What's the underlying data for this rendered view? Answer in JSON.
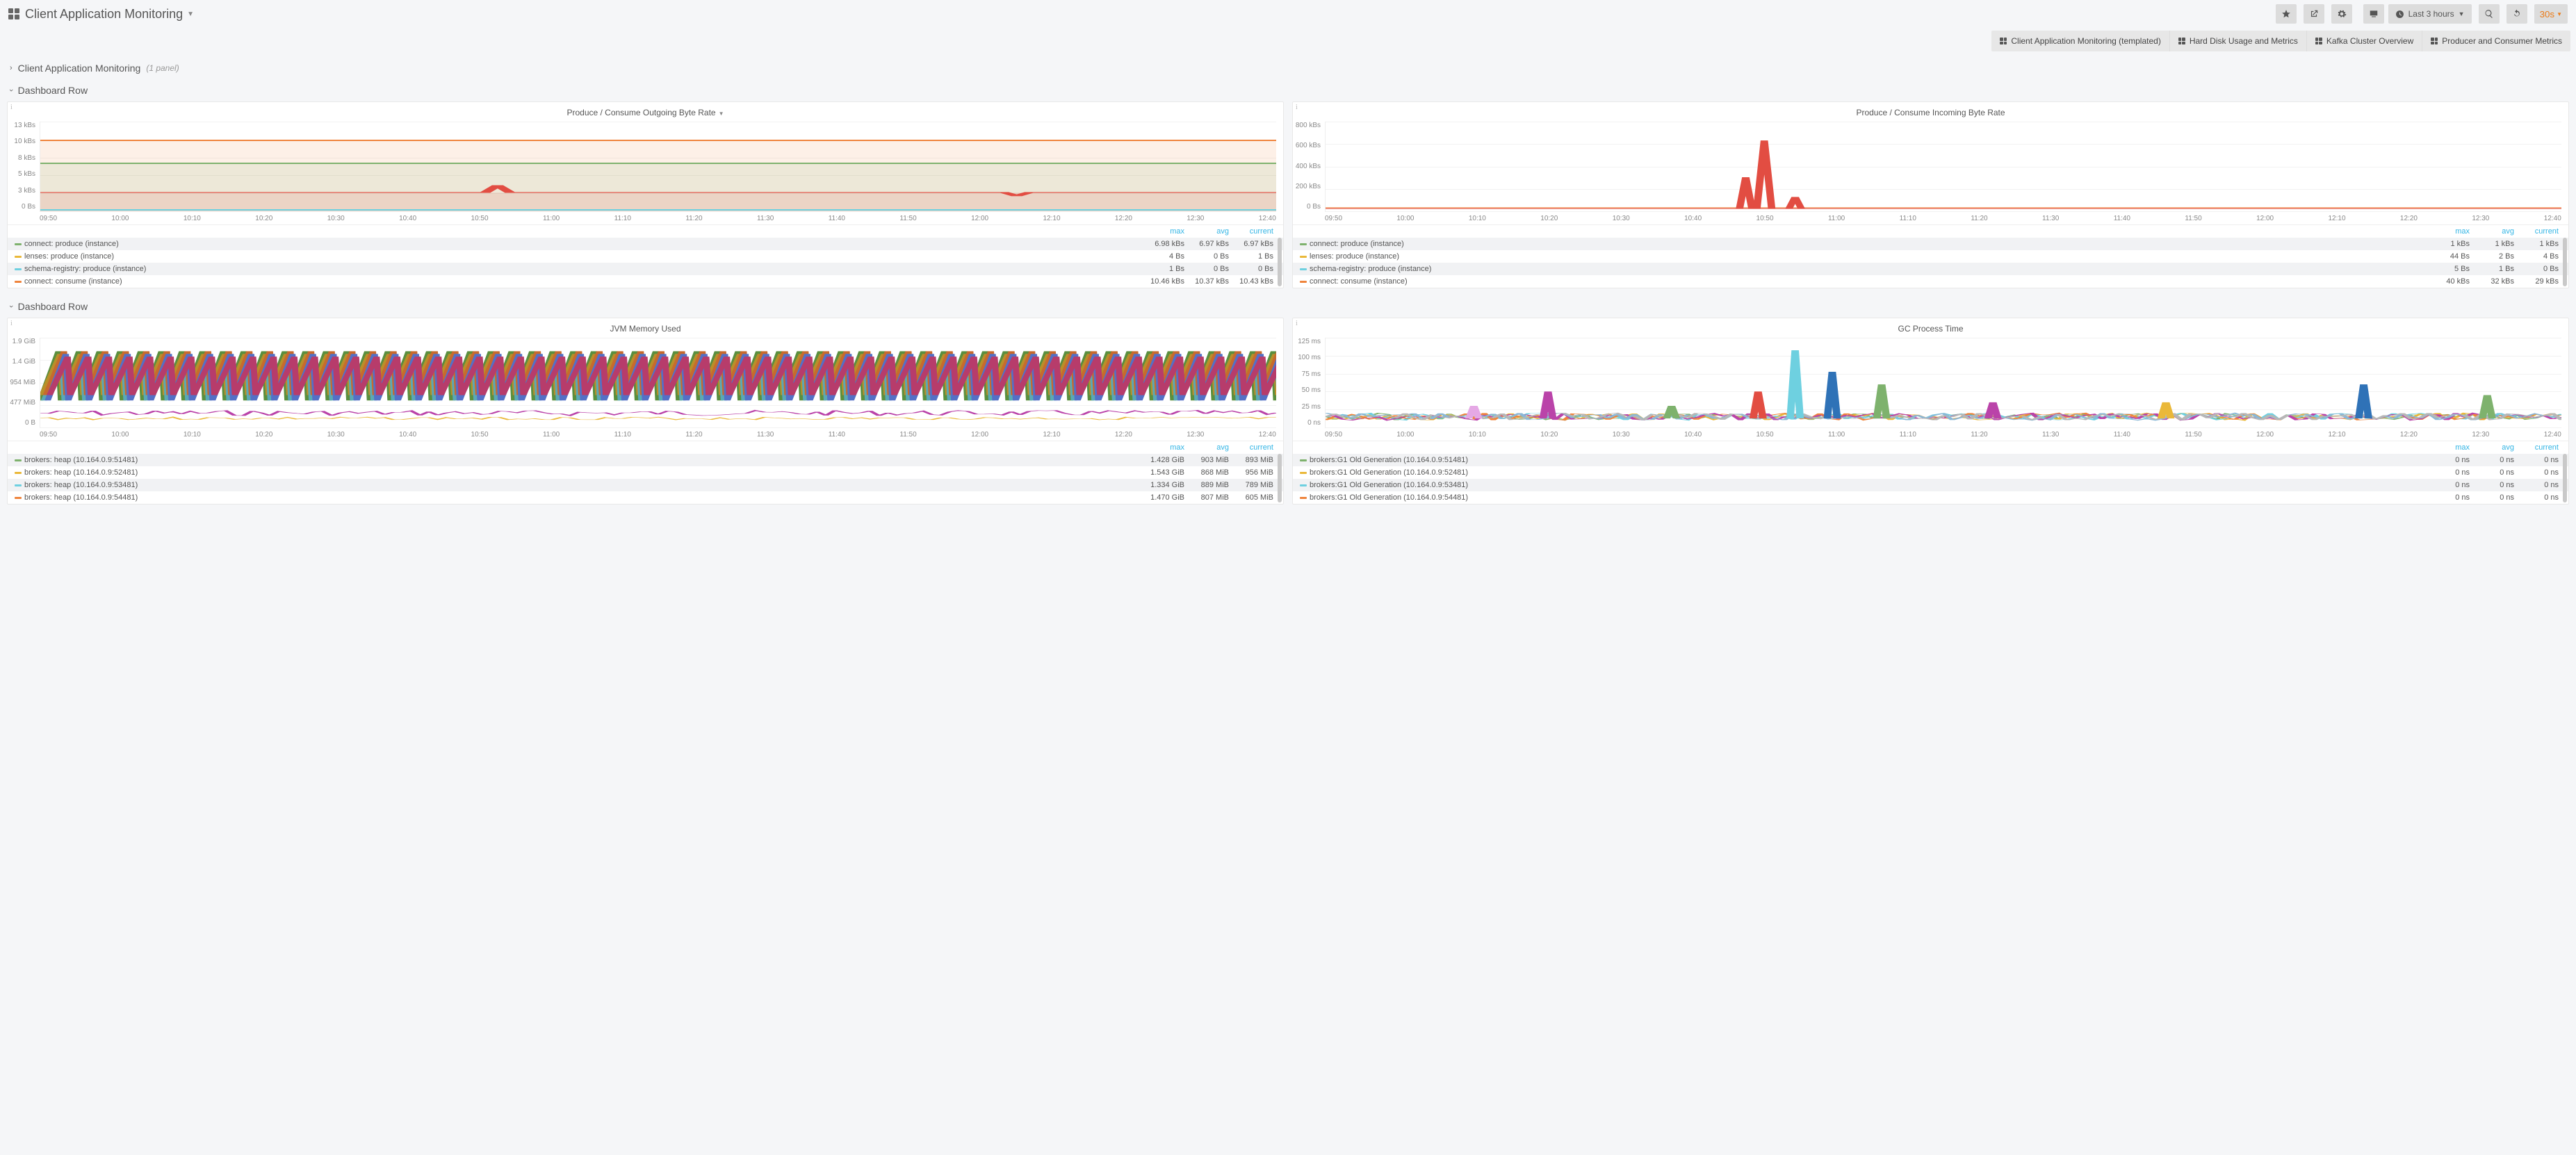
{
  "header": {
    "title": "Client Application Monitoring",
    "time_range_label": "Last 3 hours",
    "refresh_interval": "30s"
  },
  "nav_links": [
    "Client Application Monitoring (templated)",
    "Hard Disk Usage and Metrics",
    "Kafka Cluster Overview",
    "Producer and Consumer Metrics"
  ],
  "row1": {
    "title": "Client Application Monitoring",
    "sub": "(1 panel)"
  },
  "row2": {
    "title": "Dashboard Row"
  },
  "row3": {
    "title": "Dashboard Row"
  },
  "x_ticks": [
    "09:50",
    "10:00",
    "10:10",
    "10:20",
    "10:30",
    "10:40",
    "10:50",
    "11:00",
    "11:10",
    "11:20",
    "11:30",
    "11:40",
    "11:50",
    "12:00",
    "12:10",
    "12:20",
    "12:30",
    "12:40"
  ],
  "legend_cols": [
    "max",
    "avg",
    "current"
  ],
  "panels": {
    "outgoing": {
      "title": "Produce / Consume Outgoing Byte Rate",
      "y_ticks": [
        "13 kBs",
        "10 kBs",
        "8 kBs",
        "5 kBs",
        "3 kBs",
        "0 Bs"
      ],
      "legend": [
        {
          "color": "#7eb26d",
          "name": "connect: produce (instance)",
          "max": "6.98 kBs",
          "avg": "6.97 kBs",
          "cur": "6.97 kBs"
        },
        {
          "color": "#eab839",
          "name": "lenses: produce (instance)",
          "max": "4 Bs",
          "avg": "0 Bs",
          "cur": "1 Bs"
        },
        {
          "color": "#6ed0e0",
          "name": "schema-registry: produce (instance)",
          "max": "1 Bs",
          "avg": "0 Bs",
          "cur": "0 Bs"
        },
        {
          "color": "#ef843c",
          "name": "connect: consume (instance)",
          "max": "10.46 kBs",
          "avg": "10.37 kBs",
          "cur": "10.43 kBs"
        }
      ]
    },
    "incoming": {
      "title": "Produce / Consume Incoming Byte Rate",
      "y_ticks": [
        "800 kBs",
        "600 kBs",
        "400 kBs",
        "200 kBs",
        "0 Bs"
      ],
      "legend": [
        {
          "color": "#7eb26d",
          "name": "connect: produce (instance)",
          "max": "1 kBs",
          "avg": "1 kBs",
          "cur": "1 kBs"
        },
        {
          "color": "#eab839",
          "name": "lenses: produce (instance)",
          "max": "44 Bs",
          "avg": "2 Bs",
          "cur": "4 Bs"
        },
        {
          "color": "#6ed0e0",
          "name": "schema-registry: produce (instance)",
          "max": "5 Bs",
          "avg": "1 Bs",
          "cur": "0 Bs"
        },
        {
          "color": "#ef843c",
          "name": "connect: consume (instance)",
          "max": "40 kBs",
          "avg": "32 kBs",
          "cur": "29 kBs"
        }
      ]
    },
    "jvm": {
      "title": "JVM Memory Used",
      "y_ticks": [
        "1.9 GiB",
        "1.4 GiB",
        "954 MiB",
        "477 MiB",
        "0 B"
      ],
      "legend": [
        {
          "color": "#7eb26d",
          "name": "brokers: heap (10.164.0.9:51481)",
          "max": "1.428 GiB",
          "avg": "903 MiB",
          "cur": "893 MiB"
        },
        {
          "color": "#eab839",
          "name": "brokers: heap (10.164.0.9:52481)",
          "max": "1.543 GiB",
          "avg": "868 MiB",
          "cur": "956 MiB"
        },
        {
          "color": "#6ed0e0",
          "name": "brokers: heap (10.164.0.9:53481)",
          "max": "1.334 GiB",
          "avg": "889 MiB",
          "cur": "789 MiB"
        },
        {
          "color": "#ef843c",
          "name": "brokers: heap (10.164.0.9:54481)",
          "max": "1.470 GiB",
          "avg": "807 MiB",
          "cur": "605 MiB"
        }
      ]
    },
    "gc": {
      "title": "GC Process Time",
      "y_ticks": [
        "125 ms",
        "100 ms",
        "75 ms",
        "50 ms",
        "25 ms",
        "0 ns"
      ],
      "legend": [
        {
          "color": "#7eb26d",
          "name": "brokers:G1 Old Generation (10.164.0.9:51481)",
          "max": "0 ns",
          "avg": "0 ns",
          "cur": "0 ns"
        },
        {
          "color": "#eab839",
          "name": "brokers:G1 Old Generation (10.164.0.9:52481)",
          "max": "0 ns",
          "avg": "0 ns",
          "cur": "0 ns"
        },
        {
          "color": "#6ed0e0",
          "name": "brokers:G1 Old Generation (10.164.0.9:53481)",
          "max": "0 ns",
          "avg": "0 ns",
          "cur": "0 ns"
        },
        {
          "color": "#ef843c",
          "name": "brokers:G1 Old Generation (10.164.0.9:54481)",
          "max": "0 ns",
          "avg": "0 ns",
          "cur": "0 ns"
        }
      ]
    }
  },
  "chart_data": [
    {
      "panel": "outgoing",
      "type": "line",
      "title": "Produce / Consume Outgoing Byte Rate",
      "xlabel": "",
      "ylabel": "",
      "ylim": [
        0,
        13000
      ],
      "x": [
        "09:50",
        "10:00",
        "10:10",
        "10:20",
        "10:30",
        "10:40",
        "10:50",
        "11:00",
        "11:10",
        "11:20",
        "11:30",
        "11:40",
        "11:50",
        "12:00",
        "12:10",
        "12:20",
        "12:30",
        "12:40"
      ],
      "series": [
        {
          "name": "connect: consume (instance)",
          "color": "#ef843c",
          "approx_constant": 10400,
          "note": "steady ~10.4 kBs"
        },
        {
          "name": "connect: produce (instance)",
          "color": "#7eb26d",
          "approx_constant": 6970,
          "note": "steady ~6.97 kBs"
        },
        {
          "name": "red series",
          "color": "#e24d42",
          "approx_constant": 2700,
          "spikes": [
            {
              "x": "10:50",
              "y": 3700
            },
            {
              "x": "12:10",
              "y": 2100
            }
          ]
        },
        {
          "name": "schema-registry: produce (instance)",
          "color": "#6ed0e0",
          "approx_constant": 0
        },
        {
          "name": "lenses: produce (instance)",
          "color": "#eab839",
          "approx_constant": 1
        }
      ]
    },
    {
      "panel": "incoming",
      "type": "line",
      "title": "Produce / Consume Incoming Byte Rate",
      "xlabel": "",
      "ylabel": "",
      "ylim": [
        0,
        800000
      ],
      "x": [
        "09:50",
        "10:00",
        "10:10",
        "10:20",
        "10:30",
        "10:40",
        "10:50",
        "11:00",
        "11:10",
        "11:20",
        "11:30",
        "11:40",
        "11:50",
        "12:00",
        "12:10",
        "12:20",
        "12:30",
        "12:40"
      ],
      "series": [
        {
          "name": "connect: consume (instance)",
          "color": "#ef843c",
          "approx_constant": 32000,
          "note": "baseline ~30 kBs"
        },
        {
          "name": "red spike series",
          "color": "#e24d42",
          "baseline": 20000,
          "spikes": [
            {
              "x": "10:45",
              "y": 300000
            },
            {
              "x": "10:47",
              "y": 630000
            },
            {
              "x": "10:53",
              "y": 130000
            }
          ]
        },
        {
          "name": "connect: produce (instance)",
          "color": "#7eb26d",
          "approx_constant": 1000
        },
        {
          "name": "lenses: produce (instance)",
          "color": "#eab839",
          "approx_constant": 2
        },
        {
          "name": "schema-registry: produce (instance)",
          "color": "#6ed0e0",
          "approx_constant": 1
        }
      ]
    },
    {
      "panel": "jvm",
      "type": "line",
      "title": "JVM Memory Used",
      "xlabel": "",
      "ylabel": "",
      "ylim": [
        0,
        2040109466
      ],
      "x": [
        "09:50",
        "12:40"
      ],
      "series": [
        {
          "name": "brokers: heap (10.164.0.9:51481)",
          "color": "#7eb26d",
          "pattern": "sawtooth",
          "min": 477000000,
          "max": 1533000000,
          "period_min": 3
        },
        {
          "name": "brokers: heap (10.164.0.9:52481)",
          "color": "#eab839",
          "pattern": "sawtooth",
          "min": 477000000,
          "max": 1657000000,
          "period_min": 3
        },
        {
          "name": "brokers: heap (10.164.0.9:53481)",
          "color": "#6ed0e0",
          "pattern": "sawtooth",
          "min": 477000000,
          "max": 1432000000,
          "period_min": 3
        },
        {
          "name": "brokers: heap (10.164.0.9:54481)",
          "color": "#ef843c",
          "pattern": "sawtooth",
          "min": 400000000,
          "max": 1578000000,
          "period_min": 3
        },
        {
          "name": "other low series",
          "color": "#ba43a9",
          "pattern": "flat-noise",
          "min": 100000000,
          "max": 300000000
        }
      ]
    },
    {
      "panel": "gc",
      "type": "line",
      "title": "GC Process Time",
      "xlabel": "",
      "ylabel": "",
      "ylim": [
        0,
        0.125
      ],
      "x": [
        "09:50",
        "12:40"
      ],
      "series": [
        {
          "name": "mixed brokers G1 Young/Old",
          "pattern": "noise-band",
          "baseline": 0.01,
          "band": [
            0.005,
            0.02
          ],
          "spikes": [
            {
              "x": "10:10",
              "y": 0.03,
              "color": "#e5a8e5"
            },
            {
              "x": "10:20",
              "y": 0.05,
              "color": "#ba43a9"
            },
            {
              "x": "10:37",
              "y": 0.03,
              "color": "#7eb26d"
            },
            {
              "x": "10:50",
              "y": 0.05,
              "color": "#e24d42"
            },
            {
              "x": "10:55",
              "y": 0.108,
              "color": "#6ed0e0"
            },
            {
              "x": "11:02",
              "y": 0.078,
              "color": "#2f72b7"
            },
            {
              "x": "11:15",
              "y": 0.06,
              "color": "#7eb26d"
            },
            {
              "x": "11:32",
              "y": 0.035,
              "color": "#ba43a9"
            },
            {
              "x": "11:55",
              "y": 0.035,
              "color": "#eab839"
            },
            {
              "x": "12:25",
              "y": 0.06,
              "color": "#2f72b7"
            },
            {
              "x": "12:38",
              "y": 0.045,
              "color": "#7eb26d"
            }
          ]
        }
      ]
    }
  ]
}
